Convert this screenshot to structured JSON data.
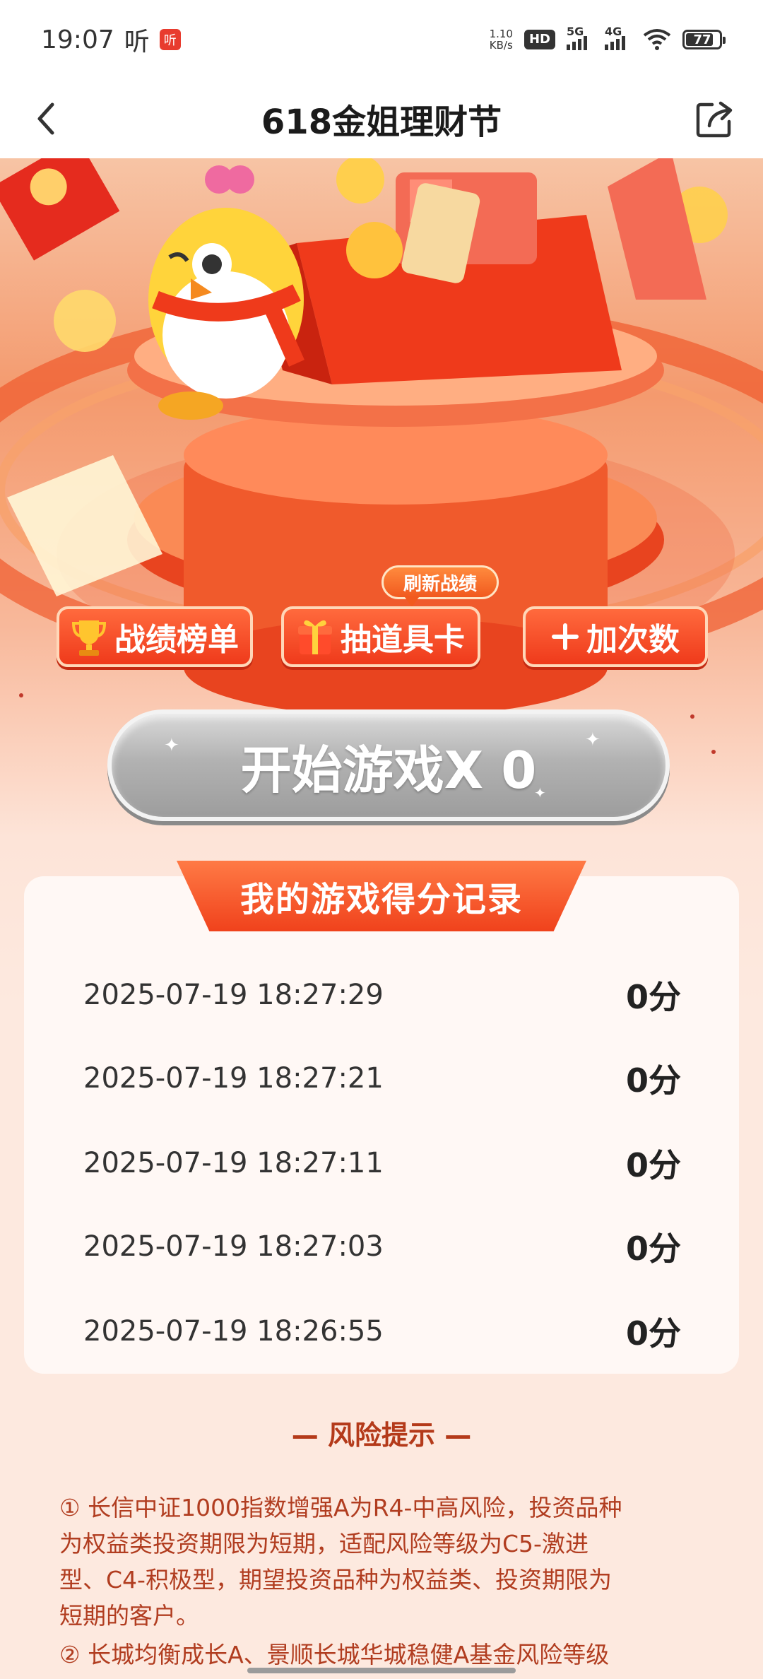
{
  "status_bar": {
    "time": "19:07",
    "listen_label": "听",
    "app_badge": "听",
    "net_speed_value": "1.10",
    "net_speed_unit": "KB/s",
    "hd_label": "HD",
    "signal_1": "5G",
    "signal_2": "4G",
    "battery": "77"
  },
  "nav": {
    "title": "618金姐理财节"
  },
  "actions": {
    "rank_label": "战绩榜单",
    "draw_label": "抽道具卡",
    "add_label": "加次数",
    "refresh_tag": "刷新战绩"
  },
  "start_button": {
    "label": "开始游戏X 0"
  },
  "records": {
    "title": "我的游戏得分记录",
    "items": [
      {
        "time": "2025-07-19 18:27:29",
        "score": "0分"
      },
      {
        "time": "2025-07-19 18:27:21",
        "score": "0分"
      },
      {
        "time": "2025-07-19 18:27:11",
        "score": "0分"
      },
      {
        "time": "2025-07-19 18:27:03",
        "score": "0分"
      },
      {
        "time": "2025-07-19 18:26:55",
        "score": "0分"
      }
    ]
  },
  "risk": {
    "title": "— 风险提示 —",
    "p1_line1": "① 长信中证1000指数增强A为R4-中高风险，投资品种",
    "p1_line2": "为权益类投资期限为短期，适配风险等级为C5-激进",
    "p1_line3": "型、C4-积极型，期望投资品种为权益类、投资期限为",
    "p1_line4": "短期的客户。",
    "p2_line1": "② 长城均衡成长A、景顺长城华城稳健A基金风险等级"
  },
  "colors": {
    "accent": "#ef3a1b",
    "risk_text": "#b13d20",
    "page_bg": "#fde9df"
  }
}
